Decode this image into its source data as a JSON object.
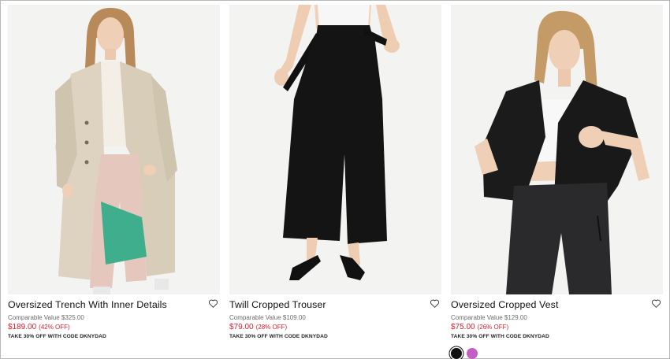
{
  "products": [
    {
      "name": "Oversized Trench With Inner Details",
      "comparable": "Comparable Value $325.00",
      "price": "$189.00",
      "discount": "(42% OFF)",
      "promo": "TAKE 30% OFF WITH CODE DKNYDAD",
      "icon": "heart-icon"
    },
    {
      "name": "Twill Cropped Trouser",
      "comparable": "Comparable Value $109.00",
      "price": "$79.00",
      "discount": "(28% OFF)",
      "promo": "TAKE 30% OFF WITH CODE DKNYDAD",
      "icon": "heart-icon"
    },
    {
      "name": "Oversized Cropped Vest",
      "comparable": "Comparable Value $129.00",
      "price": "$75.00",
      "discount": "(26% OFF)",
      "promo": "TAKE 30% OFF WITH CODE DKNYDAD",
      "icon": "heart-icon",
      "swatches": [
        {
          "color": "#111111",
          "selected": true
        },
        {
          "color": "#c45ec5",
          "selected": false
        }
      ]
    }
  ],
  "colors": {
    "sale_price": "#d6202f",
    "muted_text": "#6b6b6b",
    "image_background": "#f3f3f2"
  }
}
